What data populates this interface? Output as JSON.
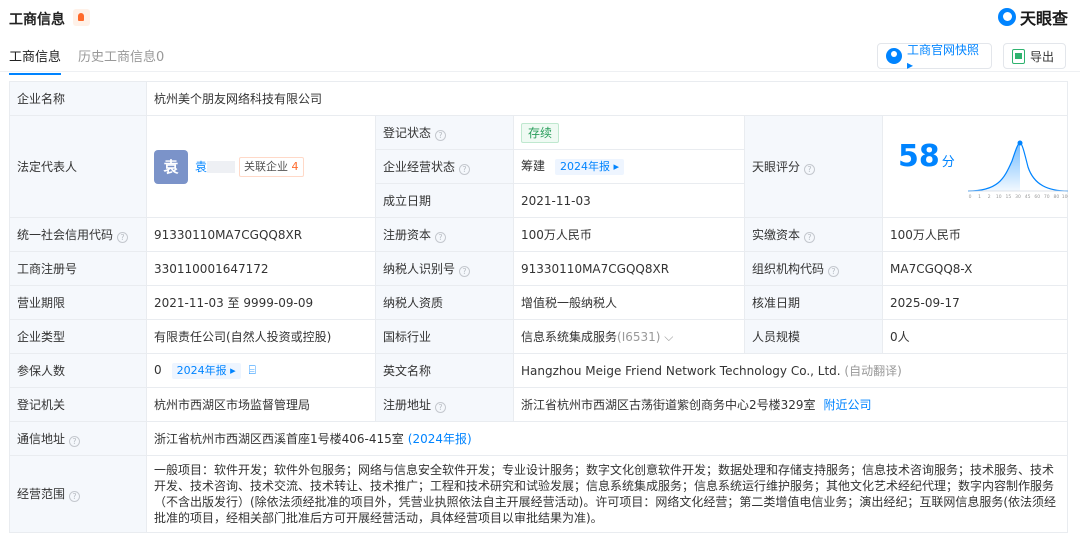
{
  "header": {
    "title": "工商信息",
    "brand": "天眼查"
  },
  "tabs": [
    {
      "label": "工商信息",
      "active": true
    },
    {
      "label": "历史工商信息0",
      "active": false
    }
  ],
  "actions": {
    "snapshot": "工商官网快照 ▸",
    "export": "导出"
  },
  "company": {
    "name_label": "企业名称",
    "name": "杭州美个朋友网络科技有限公司",
    "rep_label": "法定代表人",
    "rep_avatar": "袁",
    "rep_name": "袁",
    "related_label": "关联企业",
    "related_count": "4",
    "reg_status_label": "登记状态",
    "reg_status": "存续",
    "op_status_label": "企业经营状态",
    "op_status": "筹建",
    "annual_report": "2024年报 ▸",
    "found_label": "成立日期",
    "found_date": "2021-11-03",
    "score_label": "天眼评分",
    "score": "58",
    "score_unit": "分",
    "score_ticks": [
      "0",
      "1",
      "2",
      "10",
      "15",
      "30",
      "45",
      "60",
      "70",
      "80",
      "100"
    ],
    "credit_label": "统一社会信用代码",
    "credit_code": "91330110MA7CGQQ8XR",
    "capital_label": "注册资本",
    "capital": "100万人民币",
    "paid_label": "实缴资本",
    "paid": "100万人民币",
    "reg_no_label": "工商注册号",
    "reg_no": "330110001647172",
    "taxpayer_id_label": "纳税人识别号",
    "taxpayer_id": "91330110MA7CGQQ8XR",
    "org_code_label": "组织机构代码",
    "org_code": "MA7CGQQ8-X",
    "term_label": "营业期限",
    "term": "2021-11-03 至 9999-09-09",
    "tax_qual_label": "纳税人资质",
    "tax_qual": "增值税一般纳税人",
    "approve_label": "核准日期",
    "approve_date": "2025-09-17",
    "type_label": "企业类型",
    "type": "有限责任公司(自然人投资或控股)",
    "industry_label": "国标行业",
    "industry": "信息系统集成服务",
    "industry_code": "(I6531) ⌵",
    "staff_label": "人员规模",
    "staff": "0人",
    "insured_label": "参保人数",
    "insured": "0",
    "insured_report": "2024年报 ▸",
    "en_label": "英文名称",
    "en_name": "Hangzhou Meige Friend Network Technology Co., Ltd.",
    "en_note": "(自动翻译)",
    "authority_label": "登记机关",
    "authority": "杭州市西湖区市场监督管理局",
    "address_label": "注册地址",
    "address": "浙江省杭州市西湖区古荡街道紫创商务中心2号楼329室",
    "nearby": "附近公司",
    "contact_label": "通信地址",
    "contact": "浙江省杭州市西湖区西溪首座1号楼406-415室",
    "contact_report": "(2024年报)",
    "scope_label": "经营范围",
    "scope": "一般项目：软件开发；软件外包服务；网络与信息安全软件开发；专业设计服务；数字文化创意软件开发；数据处理和存储支持服务；信息技术咨询服务；技术服务、技术开发、技术咨询、技术交流、技术转让、技术推广；工程和技术研究和试验发展；信息系统集成服务；信息系统运行维护服务；其他文化艺术经纪代理；数字内容制作服务（不含出版发行）(除依法须经批准的项目外，凭营业执照依法自主开展经营活动)。许可项目：网络文化经营；第二类增值电信业务；演出经纪；互联网信息服务(依法须经批准的项目，经相关部门批准后方可开展经营活动，具体经营项目以审批结果为准)。"
  },
  "colors": {
    "accent": "#0084ff",
    "label_bg": "#f5f8fc",
    "status_green": "#2a9d5c",
    "orange": "#ff6a2b"
  }
}
